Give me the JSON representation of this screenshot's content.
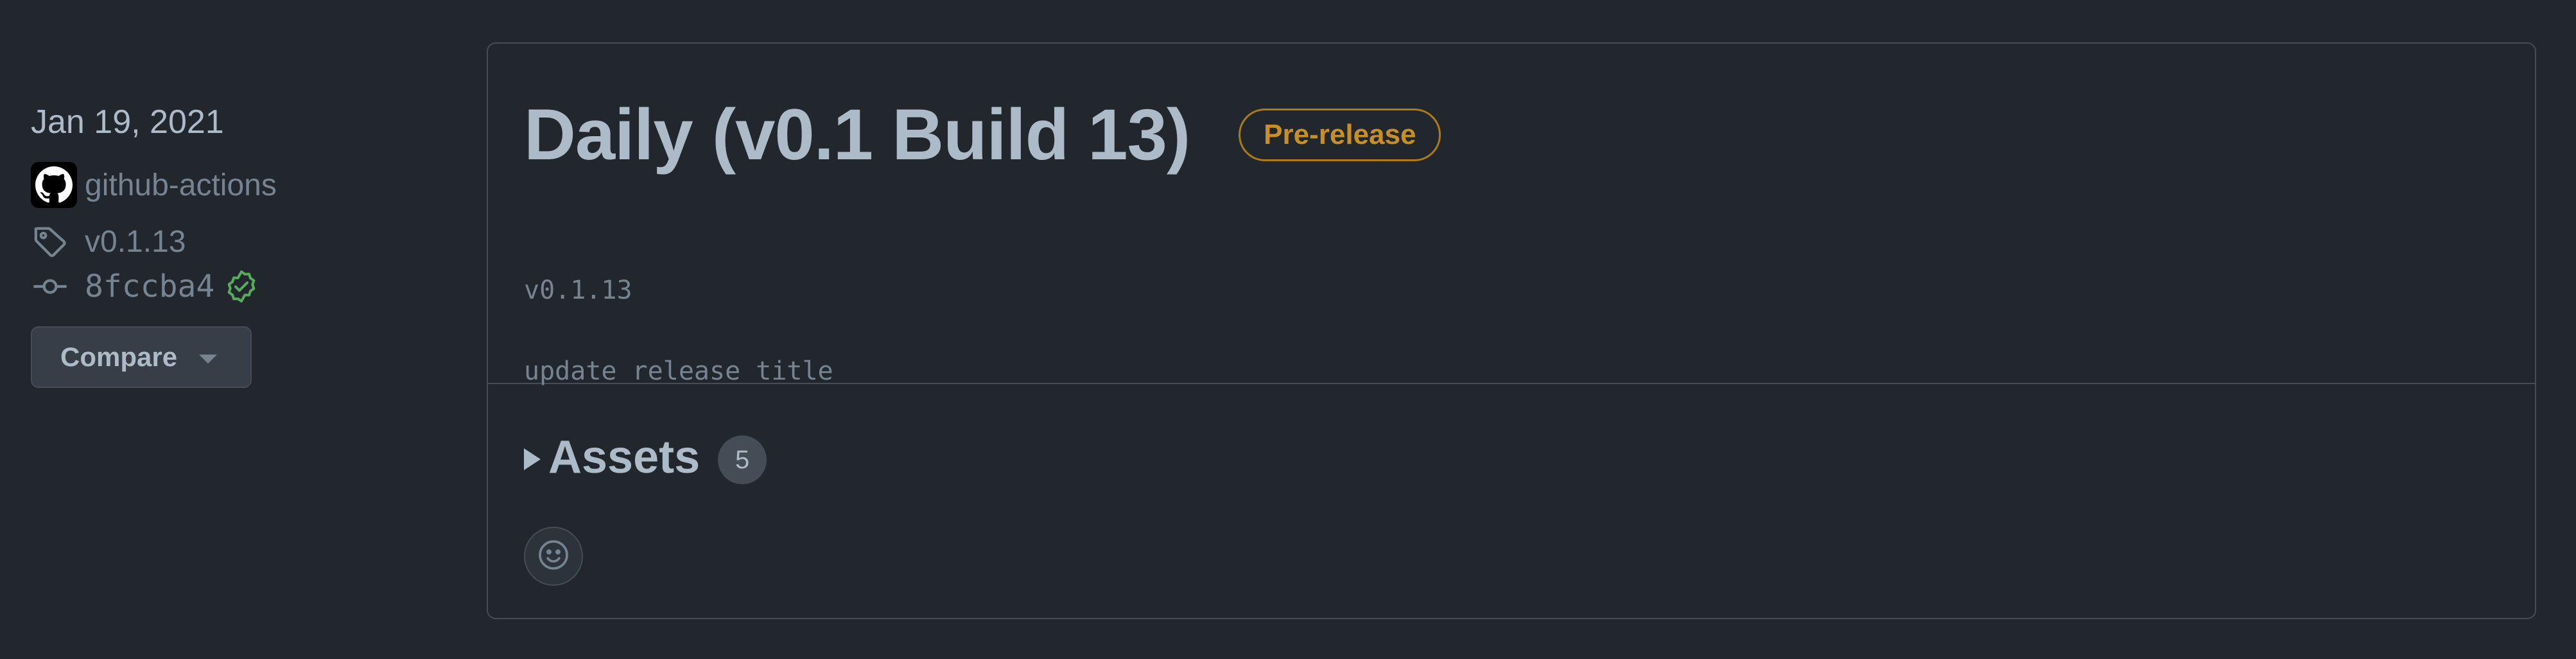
{
  "sidebar": {
    "date": "Jan 19, 2021",
    "author": "github-actions",
    "tag": "v0.1.13",
    "commit": "8fccba4",
    "compare_label": "Compare"
  },
  "release": {
    "title": "Daily (v0.1 Build 13)",
    "badge": "Pre-release",
    "notes_line1": "v0.1.13",
    "notes_line2": "update release title",
    "assets_label": "Assets",
    "assets_count": "5"
  },
  "colors": {
    "background": "#22272e",
    "badge_border": "#ae7c14",
    "badge_text": "#c69026",
    "verified_green": "#57ab5a"
  },
  "icons": {
    "avatar": "github-mark-icon",
    "tag": "tag-icon",
    "commit": "git-commit-icon",
    "verified": "verified-check-icon",
    "reaction": "smiley-icon",
    "assets_toggle": "triangle-right-icon",
    "compare_caret": "caret-down-icon"
  }
}
